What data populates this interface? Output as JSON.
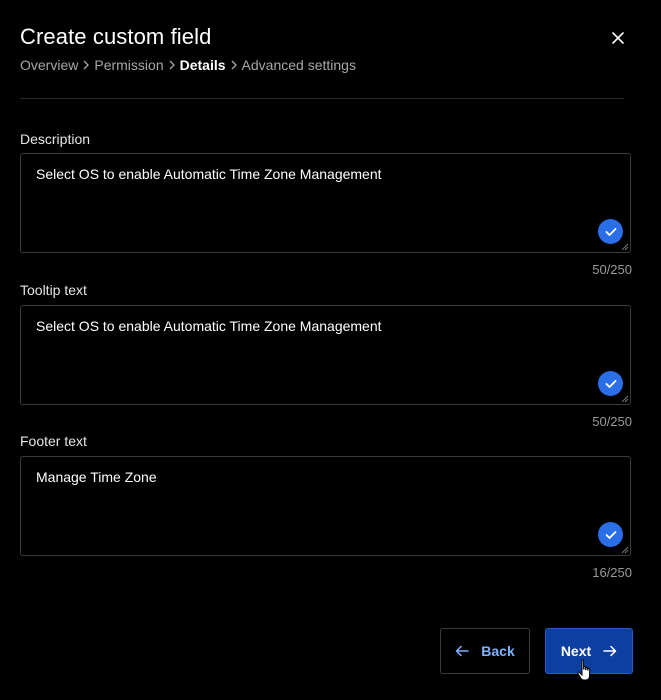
{
  "header": {
    "title": "Create custom field",
    "close_icon": "close-icon"
  },
  "breadcrumb": {
    "items": [
      "Overview",
      "Permission",
      "Details",
      "Advanced settings"
    ],
    "current_index": 2,
    "separator_icon": "chevron-right-icon"
  },
  "fields": [
    {
      "label": "Description",
      "value": "Select OS to enable Automatic Time Zone Management",
      "counter": "50/250",
      "status_icon": "check-circle-icon"
    },
    {
      "label": "Tooltip text",
      "value": "Select OS to enable Automatic Time Zone Management",
      "counter": "50/250",
      "status_icon": "check-circle-icon"
    },
    {
      "label": "Footer text",
      "value": "Manage Time Zone",
      "counter": "16/250",
      "status_icon": "check-circle-icon"
    }
  ],
  "footer": {
    "back_label": "Back",
    "back_icon": "arrow-left-icon",
    "next_label": "Next",
    "next_icon": "arrow-right-icon",
    "cursor_icon": "hand-pointer-icon"
  },
  "colors": {
    "background": "#000000",
    "accent": "#2a6ee8",
    "primary_button": "#0d3fa0",
    "link": "#7fb2ff"
  }
}
